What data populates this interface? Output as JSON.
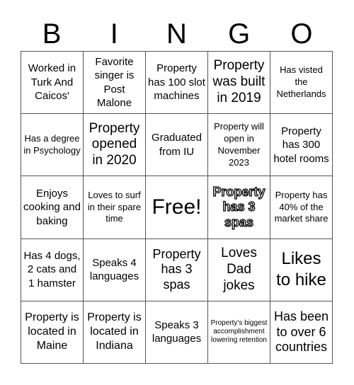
{
  "card": {
    "header": [
      "B",
      "I",
      "N",
      "G",
      "O"
    ],
    "rows": [
      [
        {
          "text": "Worked in Turk And Caicos'",
          "style": "s15"
        },
        {
          "text": "Favorite singer is Post Malone",
          "style": "s15"
        },
        {
          "text": "Property has 100 slot machines",
          "style": "s15"
        },
        {
          "text": "Property was built in 2019",
          "style": "s19"
        },
        {
          "text": "Has visted the Netherlands",
          "style": "s13"
        }
      ],
      [
        {
          "text": "Has a degree in Psychology",
          "style": "s13"
        },
        {
          "text": "Property opened in 2020",
          "style": "s19"
        },
        {
          "text": "Graduated from IU",
          "style": "s15"
        },
        {
          "text": "Property will open in November 2023",
          "style": "s13"
        },
        {
          "text": "Property has 300 hotel rooms",
          "style": "s15"
        }
      ],
      [
        {
          "text": "Enjoys cooking and baking",
          "style": "s15"
        },
        {
          "text": "Loves to surf in their spare time",
          "style": "s13"
        },
        {
          "text": "Free!",
          "style": "s30"
        },
        {
          "text": "Property has 3 spas",
          "style": "outlined"
        },
        {
          "text": "Property has 40% of the market share",
          "style": "s13"
        }
      ],
      [
        {
          "text": "Has 4 dogs, 2 cats and 1 hamster",
          "style": "s15"
        },
        {
          "text": "Speaks 4 languages",
          "style": "s15"
        },
        {
          "text": "Property has 3 spas",
          "style": "s18"
        },
        {
          "text": "Loves Dad jokes",
          "style": "s19"
        },
        {
          "text": "Likes to hike",
          "style": "s24"
        }
      ],
      [
        {
          "text": "Property is located in Maine",
          "style": "s16"
        },
        {
          "text": "Property is located in Indiana",
          "style": "s16"
        },
        {
          "text": "Speaks 3 languages",
          "style": "s15"
        },
        {
          "text": "Property's biggest accomplishment lowering retention",
          "style": "s10"
        },
        {
          "text": "Has been to over 6 countries",
          "style": "s18"
        }
      ]
    ]
  }
}
